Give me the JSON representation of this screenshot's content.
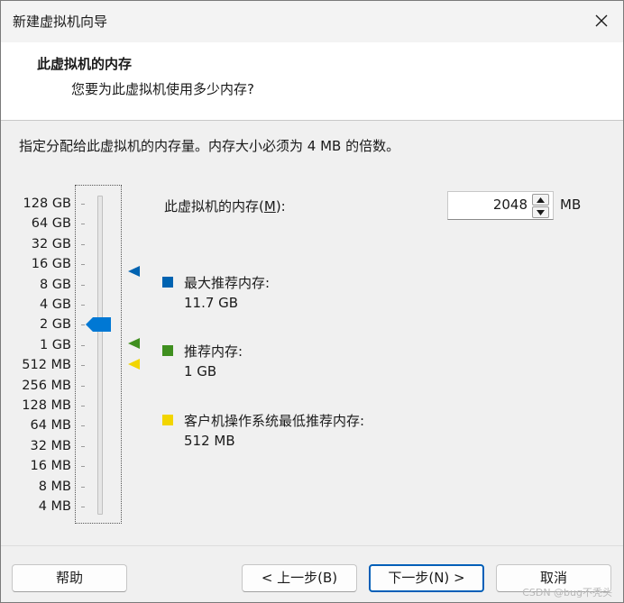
{
  "window": {
    "title": "新建虚拟机向导"
  },
  "header": {
    "title": "此虚拟机的内存",
    "subtitle": "您要为此虚拟机使用多少内存?"
  },
  "instruction": "指定分配给此虚拟机的内存量。内存大小必须为 4 MB 的倍数。",
  "slider": {
    "ticks": [
      "128 GB",
      "64 GB",
      "32 GB",
      "16 GB",
      "8 GB",
      "4 GB",
      "2 GB",
      "1 GB",
      "512 MB",
      "256 MB",
      "128 MB",
      "64 MB",
      "32 MB",
      "16 MB",
      "8 MB",
      "4 MB"
    ],
    "selected": "2 GB"
  },
  "memory": {
    "label_prefix": "此虚拟机的内存(",
    "label_key": "M",
    "label_suffix": "):",
    "value": "2048",
    "unit": "MB"
  },
  "legend": {
    "max": {
      "label": "最大推荐内存:",
      "value": "11.7 GB",
      "color": "#0063b1"
    },
    "recommended": {
      "label": "推荐内存:",
      "value": "1 GB",
      "color": "#3f8f1f"
    },
    "guest_min": {
      "label": "客户机操作系统最低推荐内存:",
      "value": "512 MB",
      "color": "#f2d500"
    }
  },
  "buttons": {
    "help": "帮助",
    "back": "< 上一步(B)",
    "next": "下一步(N) >",
    "cancel": "取消"
  },
  "watermark": "CSDN @bug不秃头"
}
